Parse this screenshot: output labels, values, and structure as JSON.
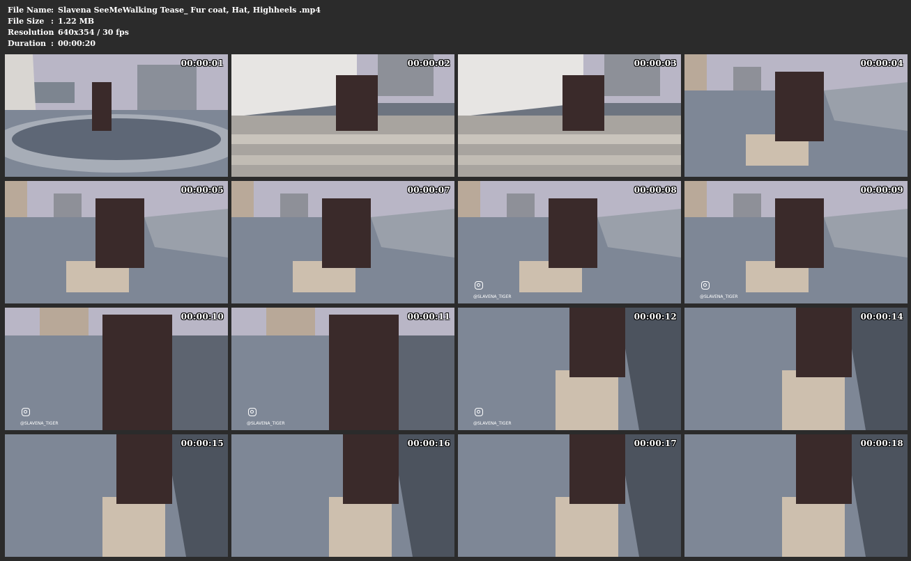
{
  "info": {
    "file_name_label": "File Name",
    "file_name": "Slavena SeeMeWalking Tease_ Fur coat, Hat, Highheels .mp4",
    "file_size_label": "File Size",
    "file_size": "1.22 MB",
    "resolution_label": "Resolution",
    "resolution": "640x354 / 30 fps",
    "duration_label": "Duration",
    "duration": "00:00:20",
    "separator": ":"
  },
  "thumbnails": [
    {
      "time": "00:00:01",
      "scene": "fountain",
      "watermark": false
    },
    {
      "time": "00:00:02",
      "scene": "steps",
      "watermark": false
    },
    {
      "time": "00:00:03",
      "scene": "steps",
      "watermark": false
    },
    {
      "time": "00:00:04",
      "scene": "road",
      "watermark": false
    },
    {
      "time": "00:00:05",
      "scene": "road",
      "watermark": false
    },
    {
      "time": "00:00:07",
      "scene": "road",
      "watermark": false
    },
    {
      "time": "00:00:08",
      "scene": "road",
      "watermark": true
    },
    {
      "time": "00:00:09",
      "scene": "road",
      "watermark": true
    },
    {
      "time": "00:00:10",
      "scene": "closeup",
      "watermark": true
    },
    {
      "time": "00:00:11",
      "scene": "closeup",
      "watermark": true
    },
    {
      "time": "00:00:12",
      "scene": "bench",
      "watermark": true
    },
    {
      "time": "00:00:14",
      "scene": "bench",
      "watermark": false
    },
    {
      "time": "00:00:15",
      "scene": "bench",
      "watermark": false
    },
    {
      "time": "00:00:16",
      "scene": "bench",
      "watermark": false
    },
    {
      "time": "00:00:17",
      "scene": "bench",
      "watermark": false
    },
    {
      "time": "00:00:18",
      "scene": "bench",
      "watermark": false
    }
  ],
  "watermark_handle": "@SLAVENA_TIGER",
  "colors": {
    "background": "#2b2b2b",
    "sky": "#b9b6c6",
    "pavement": "#7e8796",
    "coat": "#3a2a2a",
    "stone": "#cdbfae"
  }
}
